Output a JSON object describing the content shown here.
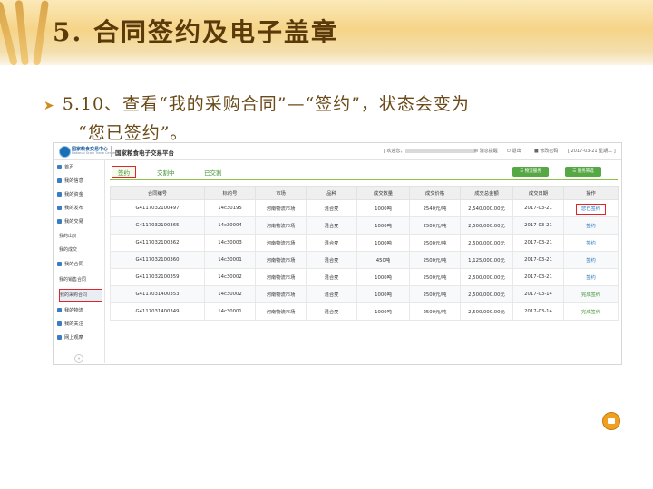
{
  "slide": {
    "title": "5. 合同签约及电子盖章",
    "bullet_line1": "5.10、查看“我的采购合同”—“签约”，状态会变为",
    "bullet_line2": "“您已签约”。"
  },
  "topbar": {
    "logo_name": "国家粮食交易中心",
    "logo_sub": "National Grain Trade Center",
    "platform": "国家粮食电子交易平台",
    "welcome": "[ 欢迎您，",
    "message": "消息提醒",
    "logout": "退出",
    "change_pwd": "修改密码",
    "date": "[ 2017-03-21 星期二 ]"
  },
  "sidebar": {
    "items": [
      "首页",
      "我的信息",
      "我的资金",
      "我的发布",
      "我的交易",
      "我的合同",
      "我的物流",
      "我的关注",
      "网上观摩"
    ],
    "trade_sub": [
      "我的出价",
      "我的成交"
    ],
    "contract_sub": [
      "我的销售合同",
      "我的采购合同"
    ]
  },
  "tabs": [
    "签约",
    "交割中",
    "已交割"
  ],
  "buttons": [
    "物流服务",
    "服务筛选"
  ],
  "table": {
    "headers": [
      "合同编号",
      "标的号",
      "市场",
      "品种",
      "成交数量",
      "成交价格",
      "成交总金额",
      "成交日期",
      "操作"
    ],
    "rows": [
      [
        "G4117032100497",
        "14c30195",
        "河南物流市场",
        "混合麦",
        "1000吨",
        "2540元/吨",
        "2,540,000.00元",
        "2017-03-21",
        "您已签约"
      ],
      [
        "G4117032100365",
        "14c30004",
        "河南物流市场",
        "混合麦",
        "1000吨",
        "2500元/吨",
        "2,500,000.00元",
        "2017-03-21",
        "签约"
      ],
      [
        "G4117032100362",
        "14c30003",
        "河南物流市场",
        "混合麦",
        "1000吨",
        "2500元/吨",
        "2,500,000.00元",
        "2017-03-21",
        "签约"
      ],
      [
        "G4117032100360",
        "14c30001",
        "河南物流市场",
        "混合麦",
        "450吨",
        "2500元/吨",
        "1,125,000.00元",
        "2017-03-21",
        "签约"
      ],
      [
        "G4117032100359",
        "14c30002",
        "河南物流市场",
        "混合麦",
        "1000吨",
        "2500元/吨",
        "2,500,000.00元",
        "2017-03-21",
        "签约"
      ],
      [
        "G4117031400353",
        "14c30002",
        "河南物流市场",
        "混合麦",
        "1000吨",
        "2500元/吨",
        "2,500,000.00元",
        "2017-03-14",
        "完成签约"
      ],
      [
        "G4117031400349",
        "14c30001",
        "河南物流市场",
        "混合麦",
        "1000吨",
        "2500元/吨",
        "2,500,000.00元",
        "2017-03-14",
        "完成签约"
      ]
    ]
  }
}
